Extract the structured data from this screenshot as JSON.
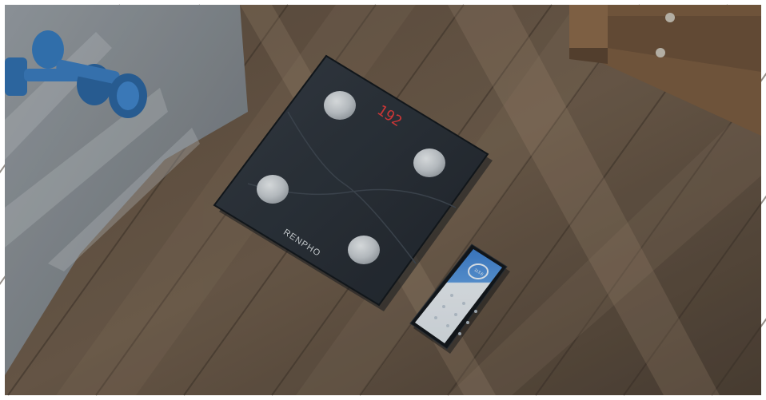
{
  "scene": {
    "scale": {
      "brand": "RENPHO",
      "display_reading": "192",
      "display_color": "#e23a3a",
      "body_color": "#2a3038",
      "electrode_color": "#cfd4d8"
    },
    "phone": {
      "screen_value": "113.6"
    },
    "dumbbell_color": "#2f6fb0",
    "rug_color": "#8a8e94",
    "floor_color": "#6d5a48"
  }
}
